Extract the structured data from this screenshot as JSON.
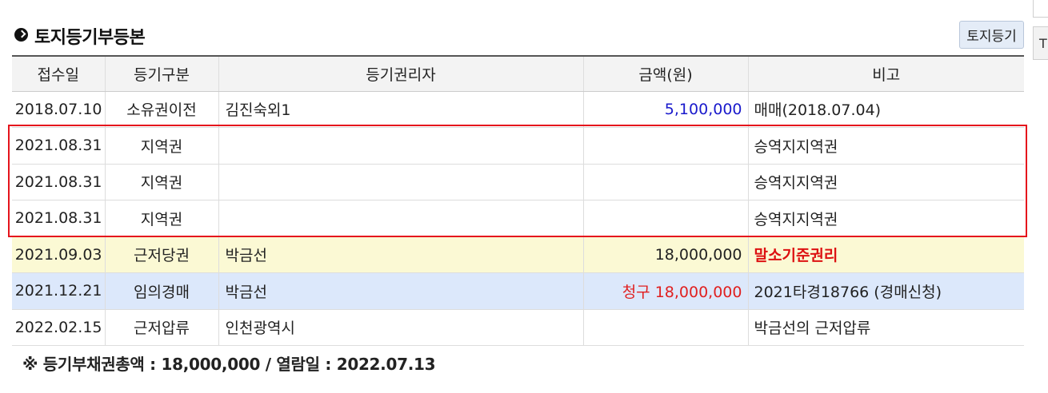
{
  "section": {
    "title": "토지등기부등본",
    "button_label": "토지등기"
  },
  "edge": {
    "letter": "T"
  },
  "table": {
    "headers": [
      "접수일",
      "등기구분",
      "등기권리자",
      "금액(원)",
      "비고"
    ],
    "rows": [
      {
        "date": "2018.07.10",
        "type": "소유권이전",
        "holder": "김진숙외1",
        "amount": "5,100,000",
        "note": "매매(2018.07.04)"
      },
      {
        "date": "2021.08.31",
        "type": "지역권",
        "holder": "",
        "amount": "",
        "note": "승역지지역권"
      },
      {
        "date": "2021.08.31",
        "type": "지역권",
        "holder": "",
        "amount": "",
        "note": "승역지지역권"
      },
      {
        "date": "2021.08.31",
        "type": "지역권",
        "holder": "",
        "amount": "",
        "note": "승역지지역권"
      },
      {
        "date": "2021.09.03",
        "type": "근저당권",
        "holder": "박금선",
        "amount": "18,000,000",
        "note": "말소기준권리"
      },
      {
        "date": "2021.12.21",
        "type": "임의경매",
        "holder": "박금선",
        "amount": "청구 18,000,000",
        "note": "2021타경18766 (경매신청)"
      },
      {
        "date": "2022.02.15",
        "type": "근저압류",
        "holder": "인천광역시",
        "amount": "",
        "note": "박금선의 근저압류"
      }
    ]
  },
  "footer": {
    "text": "※ 등기부채권총액 : 18,000,000 / 열람일 : 2022.07.13"
  },
  "colors": {
    "highlight_border": "#e5141c",
    "baseline_row_bg": "#fbf9d4",
    "auction_row_bg": "#dce8fb",
    "amount_blue": "#1a1acc",
    "amount_red": "#e02020",
    "note_red": "#dd1111"
  },
  "icons": {
    "title_bullet": "circle-arrow-right-icon"
  }
}
